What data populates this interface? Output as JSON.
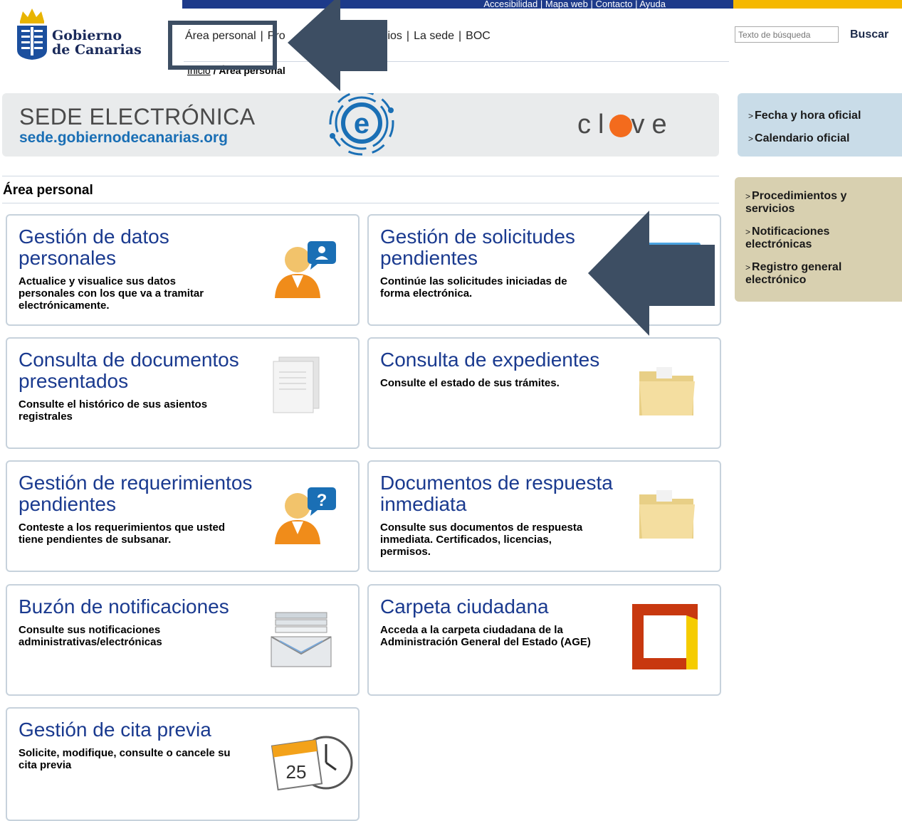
{
  "topbar": {
    "links": "Accesibilidad | Mapa web | Contacto | Ayuda"
  },
  "logo": {
    "line1": "Gobierno",
    "line2": "de Canarias"
  },
  "nav": {
    "items": [
      "Área personal",
      "Pro",
      "servicios",
      "La sede",
      "BOC"
    ]
  },
  "breadcrumb": {
    "home": "Inicio",
    "sep": " / ",
    "current": "Área personal"
  },
  "search": {
    "placeholder": "Texto de búsqueda",
    "button": "Buscar"
  },
  "banner": {
    "title": "SEDE ELECTRÓNICA",
    "url": "sede.gobiernodecanarias.org",
    "clave_left": "cl",
    "clave_right": "ve"
  },
  "side_top": {
    "links": [
      "Fecha y hora oficial",
      "Calendario oficial"
    ]
  },
  "side_bottom": {
    "links": [
      "Procedimientos y servicios",
      "Notificaciones electrónicas",
      "Registro general electrónico"
    ]
  },
  "section": {
    "title": "Área personal"
  },
  "cards": [
    {
      "title": "Gestión de datos personales",
      "desc": "Actualice y visualice sus datos personales con los que va a tramitar electrónicamente.",
      "icon": "user-info-icon"
    },
    {
      "title": "Gestión de solicitudes pendientes",
      "desc": "Continúe las solicitudes iniciadas de forma electrónica.",
      "icon": "folder-blue-icon"
    },
    {
      "title": "Consulta de documentos presentados",
      "desc": "Consulte el histórico de sus asientos registrales",
      "icon": "documents-icon"
    },
    {
      "title": "Consulta de expedientes",
      "desc": "Consulte el estado de sus trámites.",
      "icon": "folder-icon"
    },
    {
      "title": "Gestión de requerimientos pendientes",
      "desc": "Conteste a los requerimientos que usted tiene pendientes de subsanar.",
      "icon": "user-question-icon"
    },
    {
      "title": "Documentos de respuesta inmediata",
      "desc": "Consulte sus documentos de respuesta inmediata. Certificados, licencias, permisos.",
      "icon": "folder-icon"
    },
    {
      "title": "Buzón de notificaciones",
      "desc": "Consulte sus notificaciones administrativas/electrónicas",
      "icon": "mail-tray-icon"
    },
    {
      "title": "Carpeta ciudadana",
      "desc": "Acceda a la carpeta ciudadana de la Administración General del Estado (AGE)",
      "icon": "carpeta-ciudadana-icon"
    },
    {
      "title": "Gestión de cita previa",
      "desc": "Solicite, modifique, consulte o cancele su cita previa",
      "icon": "calendar-clock-icon",
      "calendar_day": "25"
    }
  ],
  "colors": {
    "title_blue": "#1a3a8f",
    "topbar": "#1d3a8a",
    "accent_yellow": "#f5b800",
    "annotation": "#3d4e63"
  }
}
